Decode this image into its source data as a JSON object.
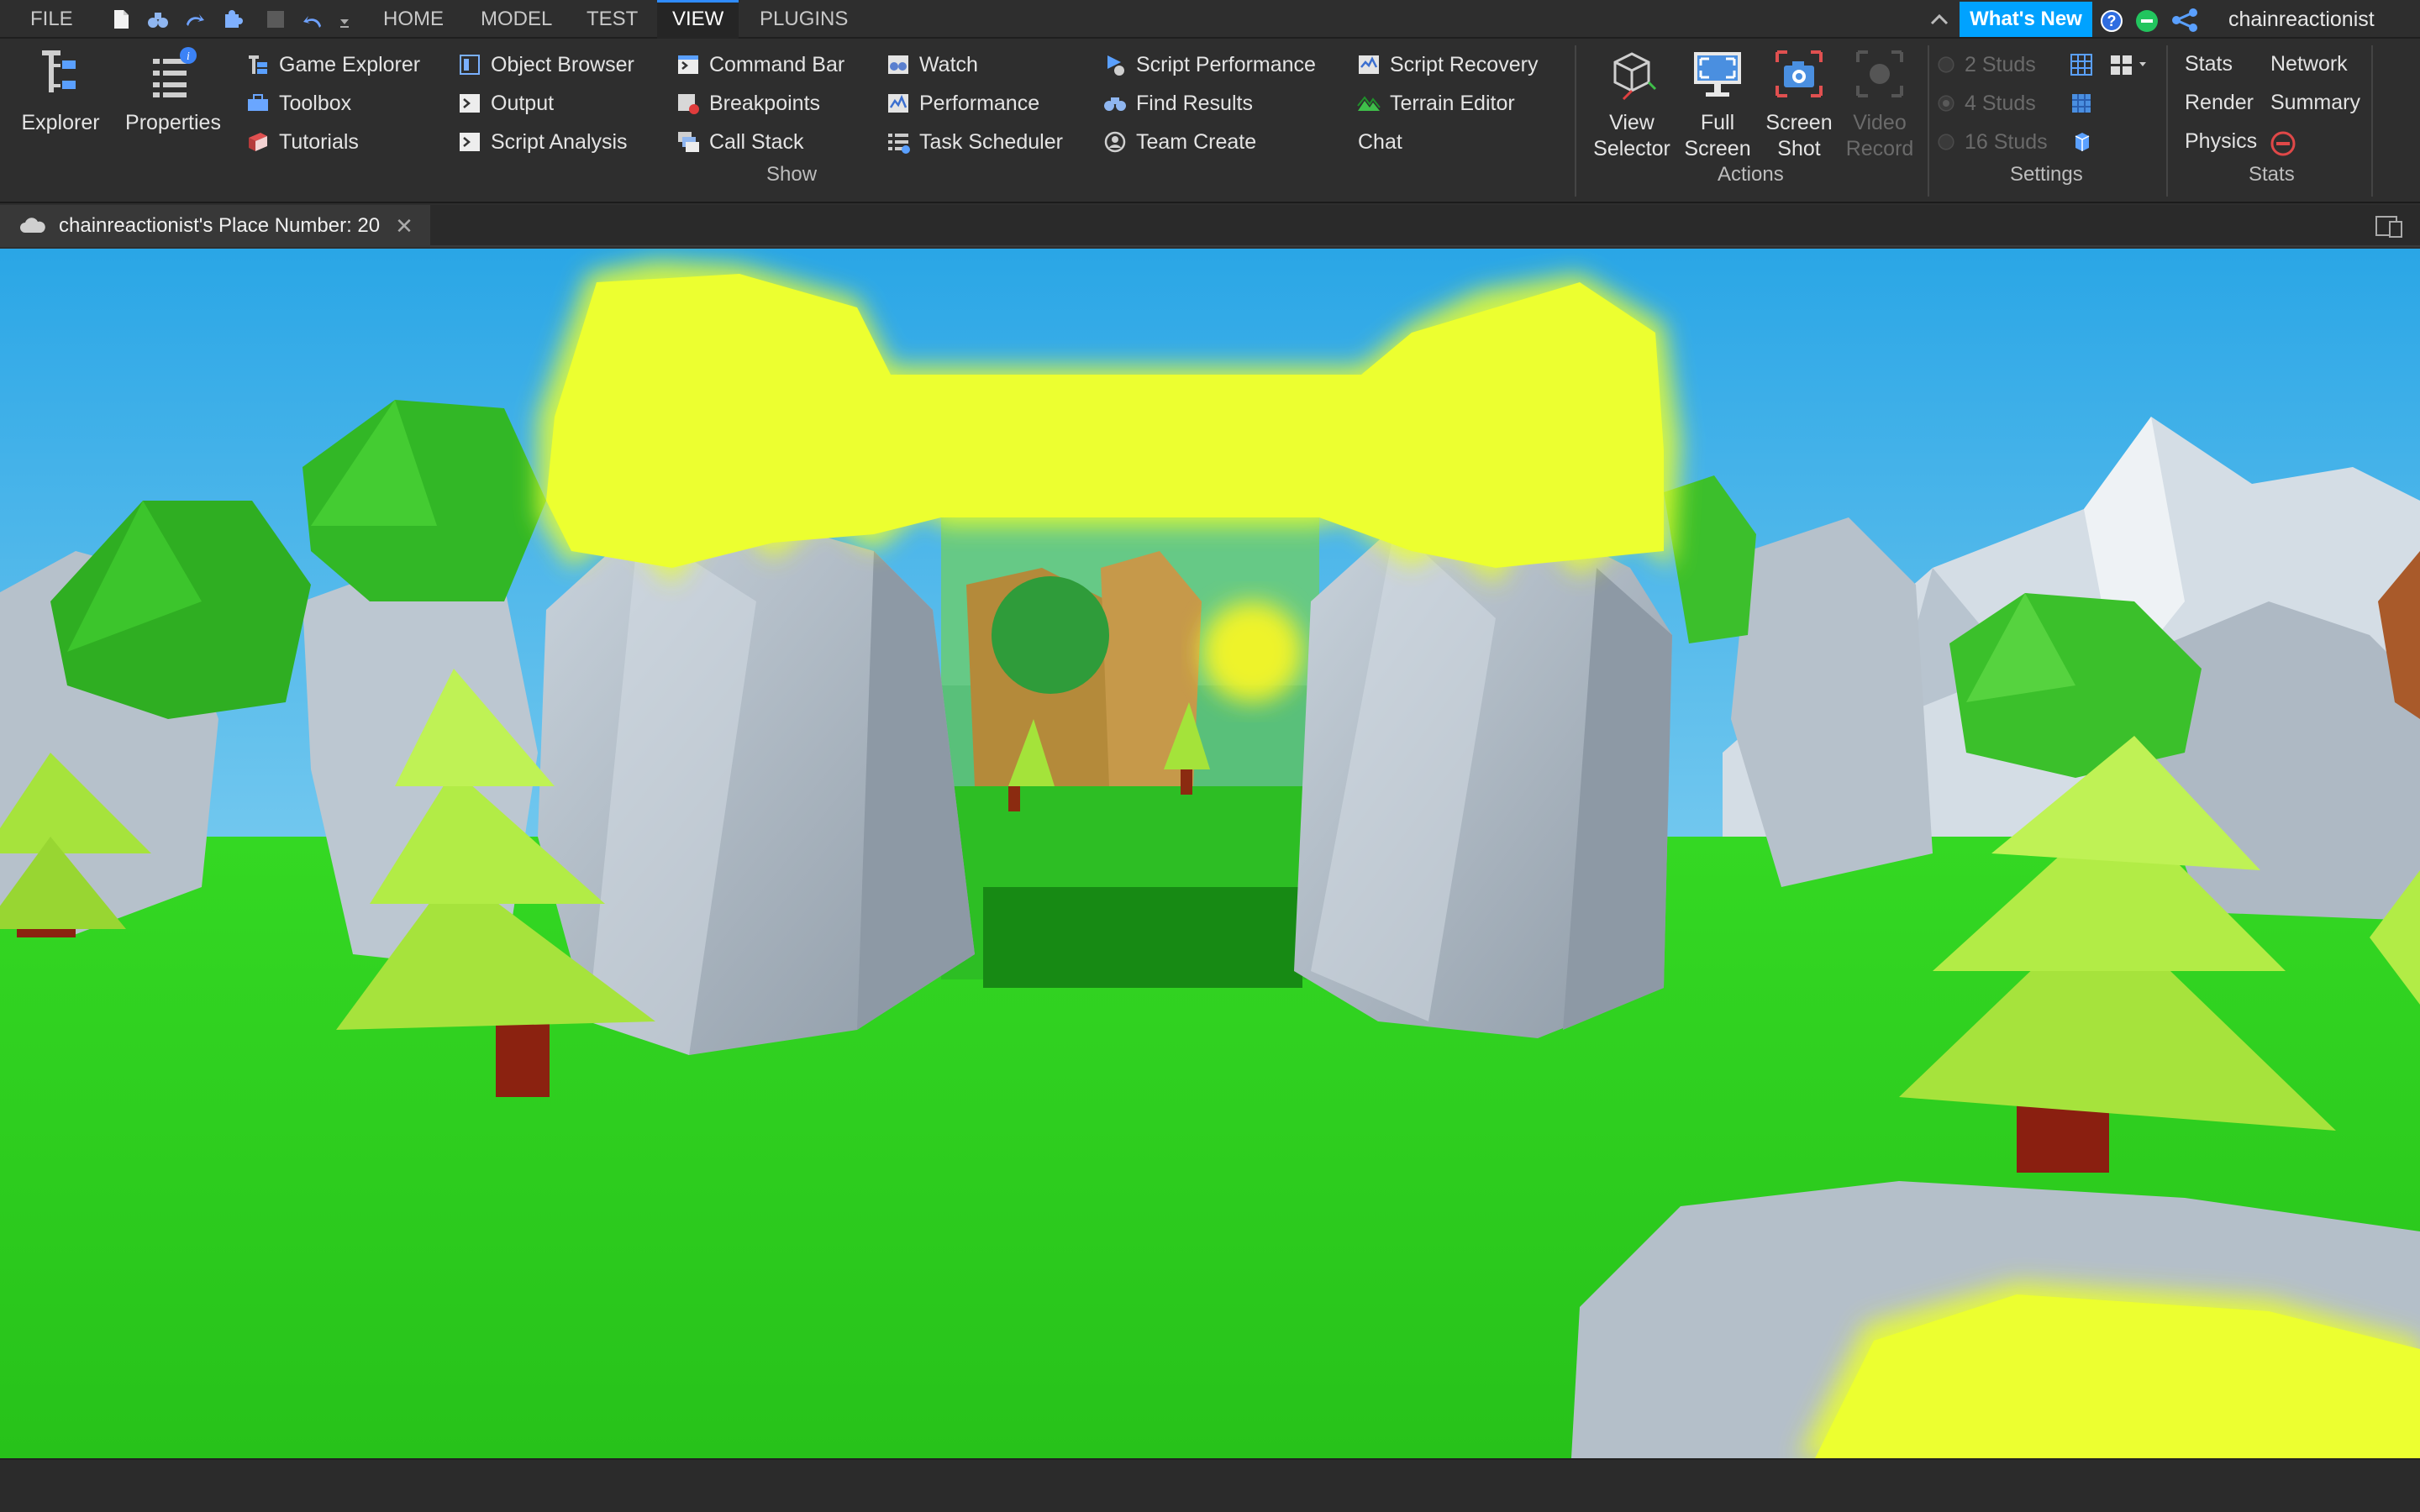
{
  "menu": {
    "file": "FILE",
    "tabs": [
      {
        "label": "HOME"
      },
      {
        "label": "MODEL"
      },
      {
        "label": "TEST"
      },
      {
        "label": "VIEW",
        "active": true
      },
      {
        "label": "PLUGINS"
      }
    ],
    "whats_new": "What's New",
    "username": "chainreactionist"
  },
  "ribbon": {
    "explorer": "Explorer",
    "properties": "Properties",
    "col1": [
      "Game Explorer",
      "Toolbox",
      "Tutorials"
    ],
    "col2": [
      "Object Browser",
      "Output",
      "Script Analysis"
    ],
    "col3": [
      "Command Bar",
      "Breakpoints",
      "Call Stack"
    ],
    "col4": [
      "Watch",
      "Performance",
      "Task Scheduler"
    ],
    "col5": [
      "Script Performance",
      "Find Results",
      "Team Create"
    ],
    "col6": [
      "Script Recovery",
      "Terrain Editor",
      "Chat"
    ],
    "show_group": "Show",
    "actions": {
      "view_selector": [
        "View",
        "Selector"
      ],
      "full_screen": [
        "Full",
        "Screen"
      ],
      "screen_shot": [
        "Screen",
        "Shot"
      ],
      "video_record": [
        "Video",
        "Record"
      ],
      "group": "Actions"
    },
    "settings": {
      "studs": [
        "2 Studs",
        "4 Studs",
        "16 Studs"
      ],
      "group": "Settings"
    },
    "stats": {
      "stats": "Stats",
      "network": "Network",
      "render": "Render",
      "summary": "Summary",
      "physics": "Physics",
      "group": "Stats"
    }
  },
  "document": {
    "tab_title": "chainreactionist's Place Number: 20",
    "close": "✕"
  },
  "colors": {
    "accent": "#00a2ff",
    "sky": "#3bb8ea",
    "grass": "#2ecc1f",
    "highlight": "#eaff2e",
    "rock": "#b3c0cc"
  }
}
